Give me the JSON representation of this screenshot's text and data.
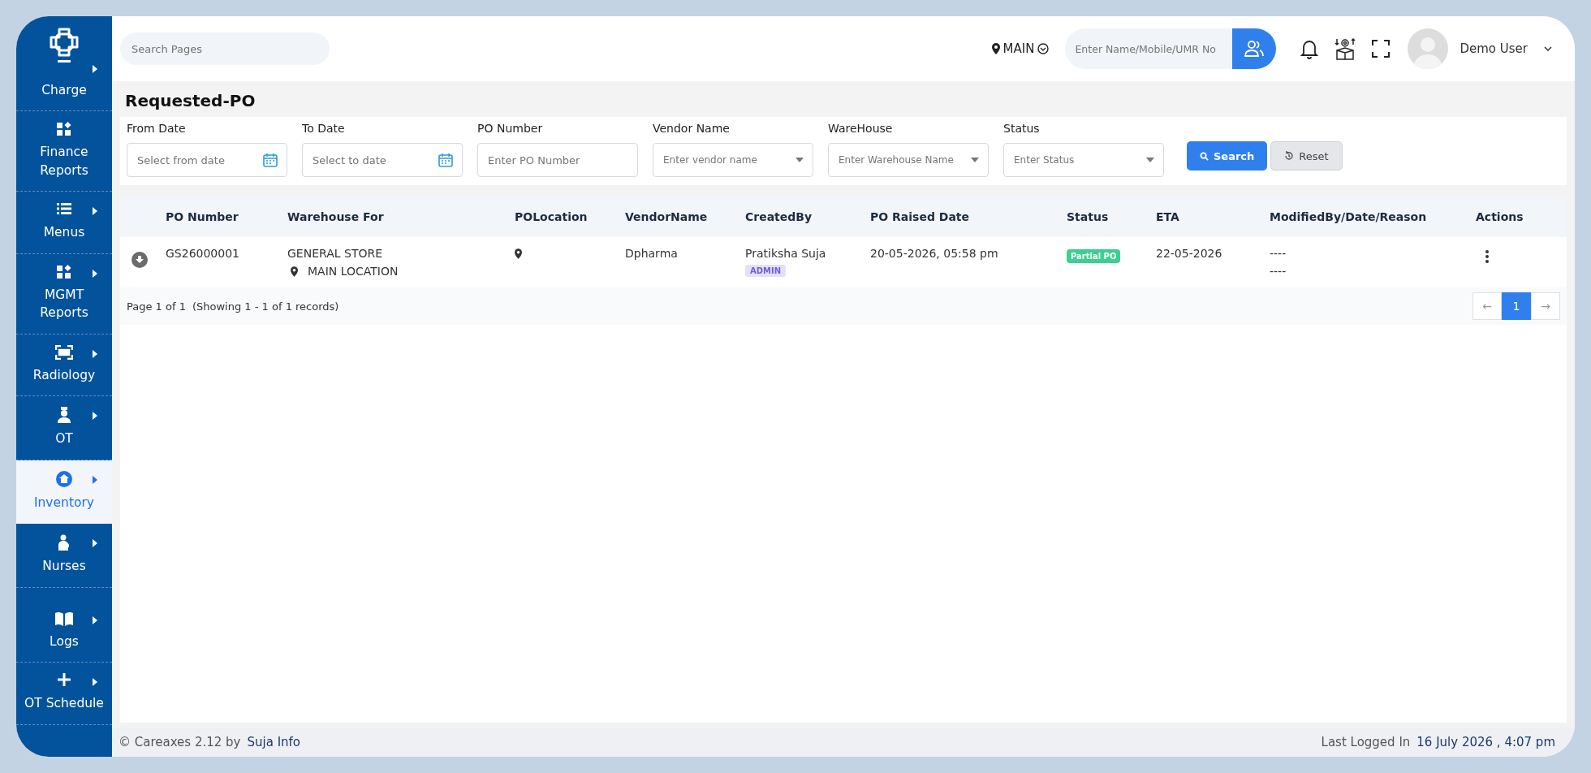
{
  "sidebar": {
    "items": [
      {
        "label": "Charge",
        "submenu": true,
        "selected": false
      },
      {
        "label": "Finance Reports",
        "submenu": false,
        "selected": false
      },
      {
        "label": "Menus",
        "submenu": true,
        "selected": false
      },
      {
        "label": "MGMT Reports",
        "submenu": true,
        "selected": false
      },
      {
        "label": "Radiology",
        "submenu": true,
        "selected": false
      },
      {
        "label": "OT",
        "submenu": true,
        "selected": false
      },
      {
        "label": "Inventory",
        "submenu": true,
        "selected": true
      },
      {
        "label": "Nurses",
        "submenu": true,
        "selected": false
      },
      {
        "label": "Logs",
        "submenu": true,
        "selected": false
      },
      {
        "label": "OT Schedule",
        "submenu": true,
        "selected": false
      }
    ]
  },
  "topbar": {
    "search": {
      "placeholder": "Search Pages"
    },
    "location": "MAIN",
    "patient_search": {
      "placeholder": "Enter Name/Mobile/UMR No"
    },
    "user": "Demo User"
  },
  "page": {
    "title": "Requested-PO"
  },
  "filters": [
    {
      "label": "From Date",
      "placeholder": "Select from date",
      "kind": "date"
    },
    {
      "label": "To Date",
      "placeholder": "Select to date",
      "kind": "date"
    },
    {
      "label": "PO Number",
      "placeholder": "Enter PO Number",
      "kind": "text"
    },
    {
      "label": "Vendor Name",
      "placeholder": "Enter vendor name",
      "kind": "select"
    },
    {
      "label": "WareHouse",
      "placeholder": "Enter Warehouse Name",
      "kind": "select"
    },
    {
      "label": "Status",
      "placeholder": "Enter Status",
      "kind": "select"
    }
  ],
  "buttons": [
    {
      "label": "Search",
      "kind": "primary"
    },
    {
      "label": "Reset",
      "kind": "secondary"
    }
  ],
  "table": {
    "columns": [
      "PO Number",
      "Warehouse For",
      "POLocation",
      "VendorName",
      "CreatedBy",
      "PO Raised Date",
      "Status",
      "ETA",
      "ModifiedBy/Date/Reason",
      "Actions"
    ],
    "rows": [
      {
        "po_number": "GS26000001",
        "warehouse": "GENERAL STORE",
        "location": "MAIN LOCATION",
        "vendor": "Dpharma",
        "created_by": "Pratiksha Suja",
        "role": "ADMIN",
        "raised_date": "20-05-2026, 05:58 pm",
        "status": {
          "label": "Partial PO",
          "color": "#3ccf91"
        },
        "eta": "22-05-2026",
        "modified": [
          "----",
          "----"
        ]
      }
    ]
  },
  "pagination": {
    "page": "Page 1 of 1",
    "showing": "(Showing 1 - 1 of 1 records)",
    "prev": "←",
    "pages": [
      {
        "label": "1",
        "selected": true
      }
    ],
    "next": "→"
  },
  "footer": {
    "copyright": "© Careaxes 2.12 by",
    "company": "Suja Info",
    "last_login_label": "Last Logged In",
    "last_login": "16 July 2026 , 4:07 pm"
  }
}
